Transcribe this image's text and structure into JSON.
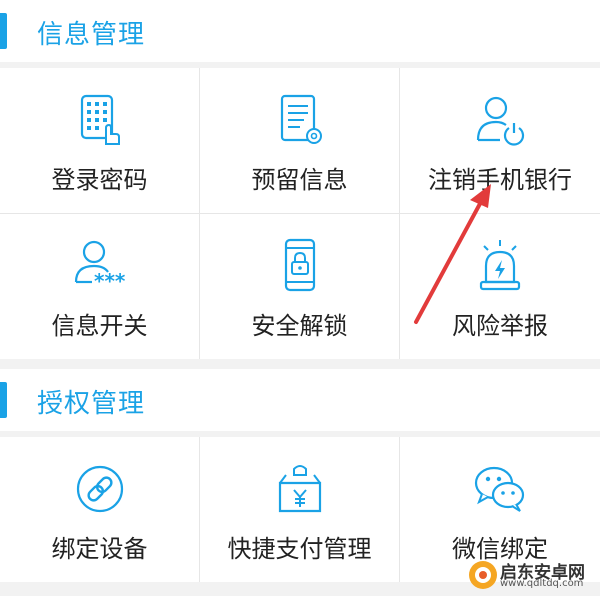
{
  "section_info": {
    "title": "信息管理",
    "items": [
      {
        "label": "登录密码",
        "icon": "keypad-touch-icon"
      },
      {
        "label": "预留信息",
        "icon": "document-gear-icon"
      },
      {
        "label": "注销手机银行",
        "icon": "user-power-icon"
      },
      {
        "label": "信息开关",
        "icon": "user-password-icon"
      },
      {
        "label": "安全解锁",
        "icon": "phone-lock-icon"
      },
      {
        "label": "风险举报",
        "icon": "alarm-siren-icon"
      }
    ]
  },
  "section_auth": {
    "title": "授权管理",
    "items": [
      {
        "label": "绑定设备",
        "icon": "link-circle-icon"
      },
      {
        "label": "快捷支付管理",
        "icon": "yen-bag-icon"
      },
      {
        "label": "微信绑定",
        "icon": "wechat-icon"
      }
    ]
  },
  "watermark": {
    "name": "启东安卓网",
    "url": "www.qdltdq.com"
  },
  "colors": {
    "accent": "#1aa2e6",
    "arrow": "#e23b3b",
    "background": "#f2f2f2"
  }
}
